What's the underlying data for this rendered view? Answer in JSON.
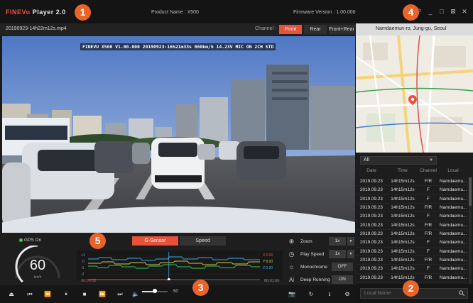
{
  "app": {
    "brand_fine": "FINE",
    "brand_vu": "Vu",
    "brand_player": "Player 2.0"
  },
  "titlebar": {
    "product": "Product Name : X500",
    "firmware": "Firmware Version : 1.00.000",
    "help": "?",
    "minimize": "_",
    "maximize": "□",
    "restore": "⊠",
    "close": "✕"
  },
  "badges": [
    "1",
    "2",
    "3",
    "4",
    "5"
  ],
  "video": {
    "filename": "20190923-14h22m12s.mp4",
    "channel_label": "Channel :",
    "channels": [
      "Front",
      "Rear",
      "Front+Rear"
    ],
    "active_channel": "Front",
    "osd": "FINEVU X500 V1.00.000  20190923-16h21m33s  060km/h 14.23V  MIC ON 2CH STD"
  },
  "map": {
    "address": "Namdaemun-ro, Jung-gu, Seoul"
  },
  "list": {
    "filter": "All",
    "columns": [
      "Date",
      "Time",
      "Channel",
      "Local"
    ],
    "rows": [
      {
        "date": "2019.09.23",
        "time": "14h15m12s",
        "channel": "F/R",
        "local": "Namdaemu..."
      },
      {
        "date": "2019.09.23",
        "time": "14h15m12s",
        "channel": "F",
        "local": "Namdaemu..."
      },
      {
        "date": "2019.09.23",
        "time": "14h15m12s",
        "channel": "F",
        "local": "Namdaemu..."
      },
      {
        "date": "2019.09.23",
        "time": "14h15m12s",
        "channel": "F/R",
        "local": "Namdaemu..."
      },
      {
        "date": "2019.09.23",
        "time": "14h15m12s",
        "channel": "F",
        "local": "Namdaemu..."
      },
      {
        "date": "2019.09.23",
        "time": "14h15m12s",
        "channel": "F/R",
        "local": "Namdaemu..."
      },
      {
        "date": "2019.09.23",
        "time": "14h15m12s",
        "channel": "F/R",
        "local": "Namdaemu..."
      },
      {
        "date": "2019.09.23",
        "time": "14h15m12s",
        "channel": "F",
        "local": "Namdaemu..."
      },
      {
        "date": "2019.09.23",
        "time": "14h15m12s",
        "channel": "F",
        "local": "Namdaemu..."
      },
      {
        "date": "2019.09.23",
        "time": "14h15m12s",
        "channel": "F/R",
        "local": "Namdaemu..."
      },
      {
        "date": "2019.09.23",
        "time": "14h15m12s",
        "channel": "F",
        "local": "Namdaemu..."
      },
      {
        "date": "2019.09.23",
        "time": "14h15m12s",
        "channel": "F/R",
        "local": "Namdaemu..."
      }
    ],
    "search_placeholder": "Local Name"
  },
  "gps": {
    "label": "GPS On",
    "speed": "60",
    "unit": "km/h",
    "gauge_fraction": 0.5
  },
  "sensor": {
    "tabs": [
      "G-Sensor",
      "Speed"
    ],
    "active_tab": "G-Sensor",
    "y_ticks": [
      "+1",
      "0",
      "-1",
      "-2"
    ],
    "readouts": [
      {
        "label": "X:0.00",
        "color": "#e8523a"
      },
      {
        "label": "Y:0.00",
        "color": "#d9c23a"
      },
      {
        "label": "Z:0.00",
        "color": "#3aa7e8"
      }
    ],
    "time_start": "00:00:30",
    "time_end": "00:01:00",
    "cursor_fraction": 0.47
  },
  "controls": {
    "zoom": {
      "label": "Zoom",
      "value": "1x"
    },
    "play_speed": {
      "label": "Play Speed",
      "value": "1x"
    },
    "monochrome": {
      "label": "Monochrome",
      "value": "OFF"
    },
    "deep_running": {
      "label": "Deep Running",
      "value": "ON",
      "icon_text": "Ai"
    }
  },
  "playback": {
    "volume": "50",
    "volume_fraction": 0.5
  }
}
